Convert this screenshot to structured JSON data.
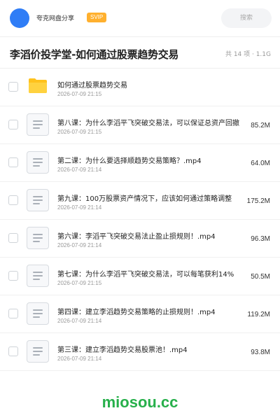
{
  "header": {
    "share_name": "夸克网盘分享",
    "badge": "SVIP",
    "search_placeholder": "搜索"
  },
  "folder": {
    "title": "李滔价投学堂-如何通过股票趋势交易",
    "meta": "共 14 项 · 1.1G"
  },
  "files": [
    {
      "type": "folder",
      "name": "如何通过股票趋势交易",
      "date": "2026-07-09 21:15",
      "size": ""
    },
    {
      "type": "file",
      "name": "第八课：为什么李滔平飞突破交易法，可以保证总资产回撤",
      "date": "2026-07-09 21:15",
      "size": "85.2M"
    },
    {
      "type": "file",
      "name": "第二课：为什么要选择顺趋势交易策略？.mp4",
      "date": "2026-07-09 21:14",
      "size": "64.0M"
    },
    {
      "type": "file",
      "name": "第九课：100万股票资产情况下，应该如何通过策略调整",
      "date": "2026-07-09 21:14",
      "size": "175.2M"
    },
    {
      "type": "file",
      "name": "第六课：李滔平飞突破交易法止盈止损规则！.mp4",
      "date": "2026-07-09 21:14",
      "size": "96.3M"
    },
    {
      "type": "file",
      "name": "第七课：为什么李滔平飞突破交易法，可以每笔获利14%",
      "date": "2026-07-09 21:15",
      "size": "50.5M"
    },
    {
      "type": "file",
      "name": "第四课：建立李滔趋势交易策略的止损规则！.mp4",
      "date": "2026-07-09 21:14",
      "size": "119.2M"
    },
    {
      "type": "file",
      "name": "第三课：建立李滔趋势交易股票池！.mp4",
      "date": "2026-07-09 21:14",
      "size": "93.8M"
    }
  ],
  "watermark": "miosou.cc",
  "colors": {
    "accent": "#2f7df6",
    "badge": "#ffb02e",
    "folder": "#ffc21c",
    "watermark": "#27b04b"
  }
}
